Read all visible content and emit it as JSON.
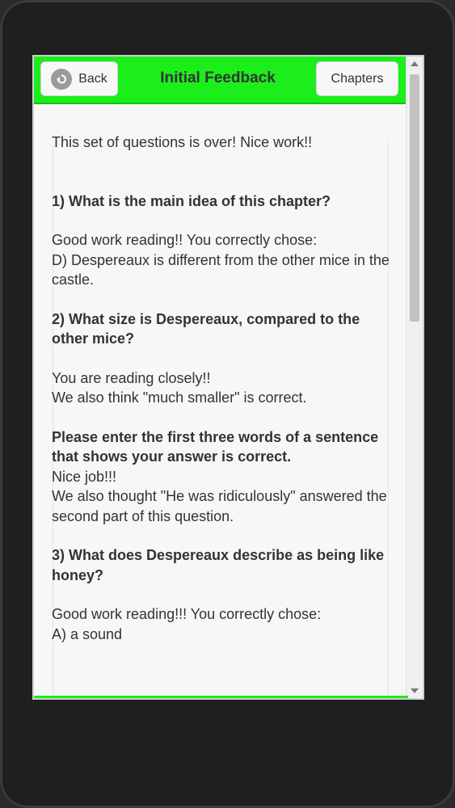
{
  "header": {
    "back_label": "Back",
    "title": "Initial Feedback",
    "chapters_label": "Chapters"
  },
  "content": {
    "intro": "This set of questions is over! Nice work!!",
    "q1": "1) What is the main idea of this chapter?",
    "a1_line1": "Good work reading!! You correctly chose:",
    "a1_line2": "D) Despereaux is different from the other mice in the castle.",
    "q2": "2) What size is Despereaux, compared to the other mice?",
    "a2_line1": "You are reading closely!!",
    "a2_line2": "We also think \"much smaller\" is correct.",
    "q2b": "Please enter the first three words of a sentence that shows your answer is correct.",
    "a2b_line1": "Nice job!!!",
    "a2b_line2": "We also thought \"He was ridiculously\" answered the second part of this question.",
    "q3": "3) What does Despereaux describe as being like honey?",
    "a3_line1": "Good work reading!!! You correctly chose:",
    "a3_line2": "A) a sound"
  },
  "icons": {
    "back": "back-arrow-circle-icon",
    "scroll_up": "scroll-up-arrow-icon",
    "scroll_down": "scroll-down-arrow-icon"
  },
  "colors": {
    "header_bg": "#1cee1c",
    "device_bg": "#1f1f21"
  }
}
